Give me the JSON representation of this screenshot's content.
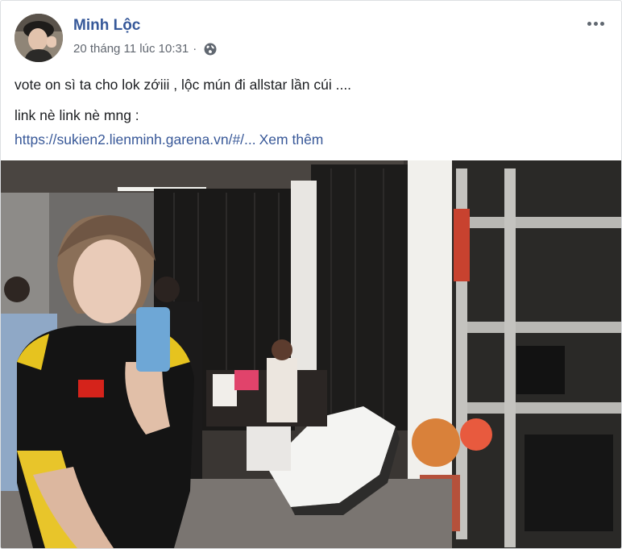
{
  "post": {
    "author": "Minh Lộc",
    "timestamp": "20 tháng 11 lúc 10:31",
    "separator": "·",
    "privacy_icon": "globe-icon",
    "more_icon": "more-options-icon",
    "text_line1": "vote on sì ta cho lok zớiii , lộc mún đi allstar lần cúi ....",
    "text_line2": "link nè link nè mng :",
    "link_text": "https://sukien2.lienminh.garena.vn/#/...",
    "see_more": "Xem thêm"
  },
  "photo": {
    "alt": "mirror selfie in a backstage dressing room"
  },
  "colors": {
    "author": "#365899",
    "link": "#385898",
    "meta": "#616770"
  }
}
